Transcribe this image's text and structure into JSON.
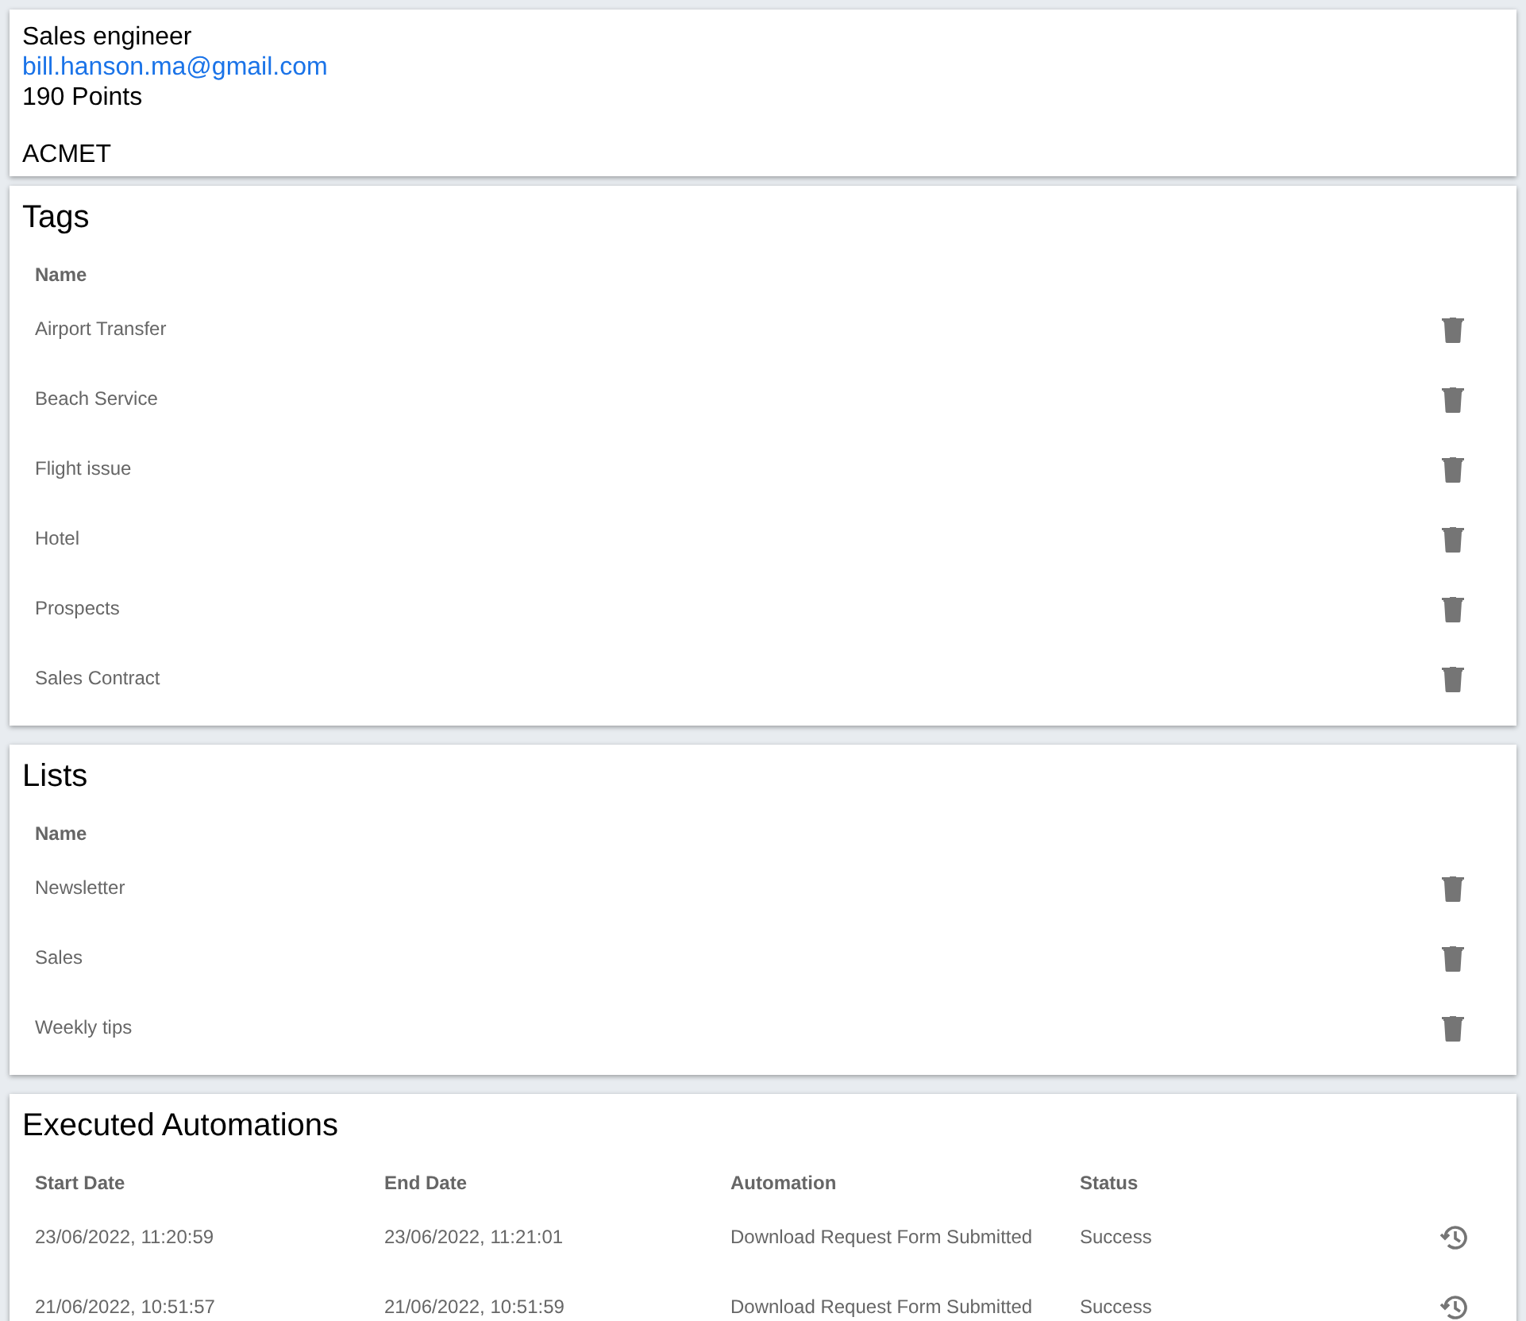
{
  "profile": {
    "job_title": "Sales engineer",
    "email": "bill.hanson.ma@gmail.com",
    "points": "190 Points",
    "company": "ACMET"
  },
  "tags": {
    "title": "Tags",
    "column": "Name",
    "rows": [
      {
        "name": "Airport Transfer"
      },
      {
        "name": "Beach Service"
      },
      {
        "name": "Flight issue"
      },
      {
        "name": "Hotel"
      },
      {
        "name": "Prospects"
      },
      {
        "name": "Sales Contract"
      }
    ]
  },
  "lists": {
    "title": "Lists",
    "column": "Name",
    "rows": [
      {
        "name": "Newsletter"
      },
      {
        "name": "Sales"
      },
      {
        "name": "Weekly tips"
      }
    ]
  },
  "automations": {
    "title": "Executed Automations",
    "columns": [
      "Start Date",
      "End Date",
      "Automation",
      "Status"
    ],
    "rows": [
      {
        "start": "23/06/2022, 11:20:59",
        "end": "23/06/2022, 11:21:01",
        "automation": "Download Request Form Submitted",
        "status": "Success"
      },
      {
        "start": "21/06/2022, 10:51:57",
        "end": "21/06/2022, 10:51:59",
        "automation": "Download Request Form Submitted",
        "status": "Success"
      }
    ]
  }
}
